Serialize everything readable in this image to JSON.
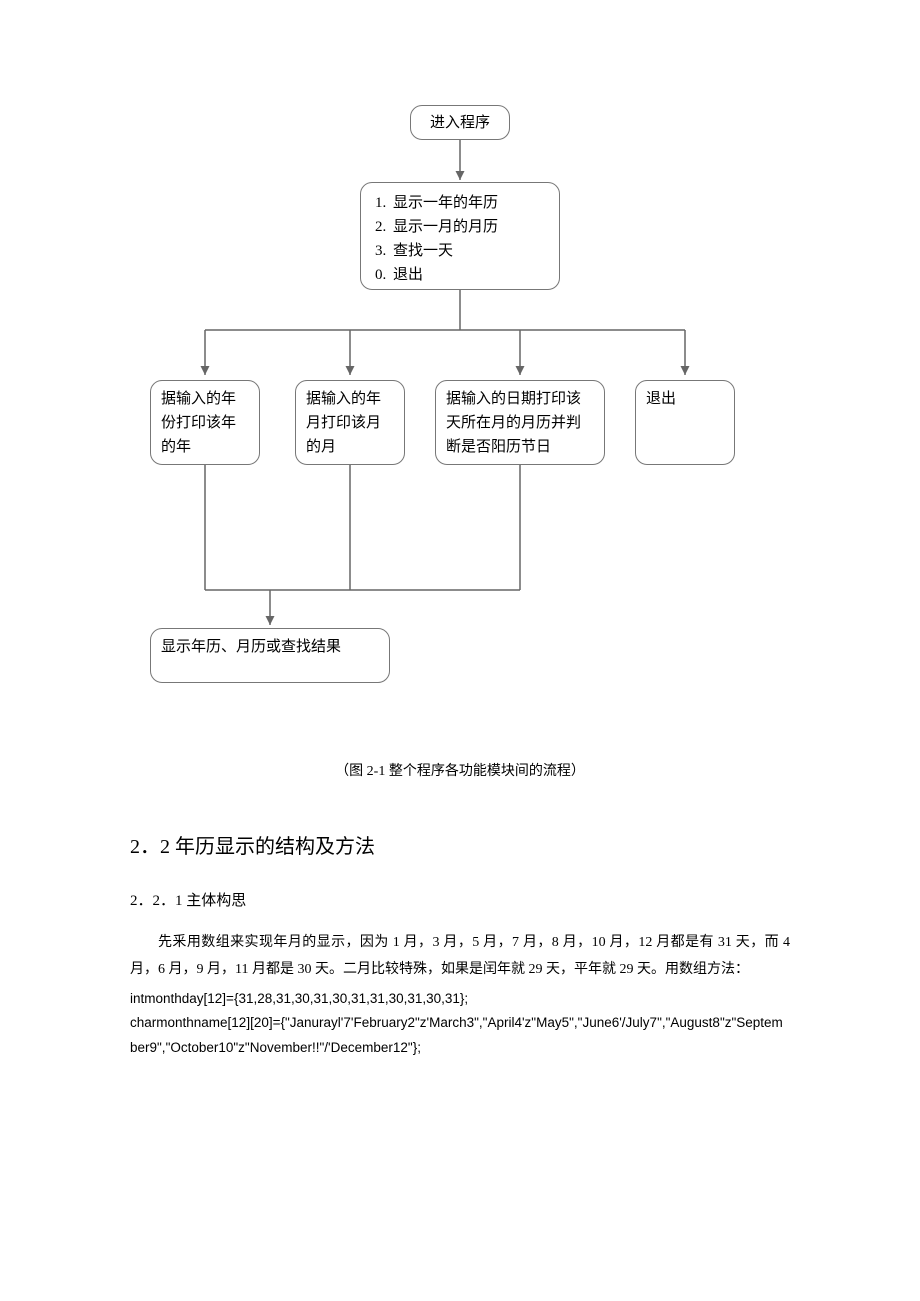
{
  "flow": {
    "start": "进入程序",
    "menu": {
      "items": [
        {
          "n": "1.",
          "label": "显示一年的年历"
        },
        {
          "n": "2.",
          "label": "显示一月的月历"
        },
        {
          "n": "3.",
          "label": "查找一天"
        },
        {
          "n": "0.",
          "label": "退出"
        }
      ]
    },
    "branch1": "据输入的年份打印该年的年",
    "branch2": "据输入的年月打印该月的月",
    "branch3": "据输入的日期打印该天所在月的月历并判断是否阳历节日",
    "branch4": "退出",
    "end": "显示年历、月历或查找结果"
  },
  "caption": "（图 2-1 整个程序各功能模块间的流程）",
  "section": "2．2 年历显示的结构及方法",
  "subsection": "2．2．1 主体构思",
  "para1": "先釆用数组来实现年月的显示，因为 1 月，3 月，5 月，7 月，8 月，10 月，12 月都是有 31 天，而 4 月，6 月，9 月，11 月都是 30 天。二月比较特殊，如果是闰年就 29 天，平年就 29 天。用数组方法：",
  "code1": "intmonthday[12]={31,28,31,30,31,30,31,31,30,31,30,31};",
  "code2": "charmonthname[12][20]={\"Janurayl'7'February2\"z'March3\",\"April4'z\"May5\",\"June6'/July7\",\"August8\"z\"September9\",\"October10\"z\"November!!\"/'December12\"};",
  "chart_data": {
    "type": "flowchart",
    "nodes": [
      {
        "id": "start",
        "label": "进入程序"
      },
      {
        "id": "menu",
        "label": "1. 显示一年的年历 / 2. 显示一月的月历 / 3. 查找一天 / 0. 退出"
      },
      {
        "id": "b1",
        "label": "据输入的年份打印该年的年"
      },
      {
        "id": "b2",
        "label": "据输入的年月打印该月的月"
      },
      {
        "id": "b3",
        "label": "据输入的日期打印该天所在月的月历并判断是否阳历节日"
      },
      {
        "id": "b4",
        "label": "退出"
      },
      {
        "id": "end",
        "label": "显示年历、月历或查找结果"
      }
    ],
    "edges": [
      [
        "start",
        "menu"
      ],
      [
        "menu",
        "b1"
      ],
      [
        "menu",
        "b2"
      ],
      [
        "menu",
        "b3"
      ],
      [
        "menu",
        "b4"
      ],
      [
        "b1",
        "end"
      ],
      [
        "b2",
        "end"
      ],
      [
        "b3",
        "end"
      ],
      [
        "end",
        "menu"
      ]
    ]
  }
}
